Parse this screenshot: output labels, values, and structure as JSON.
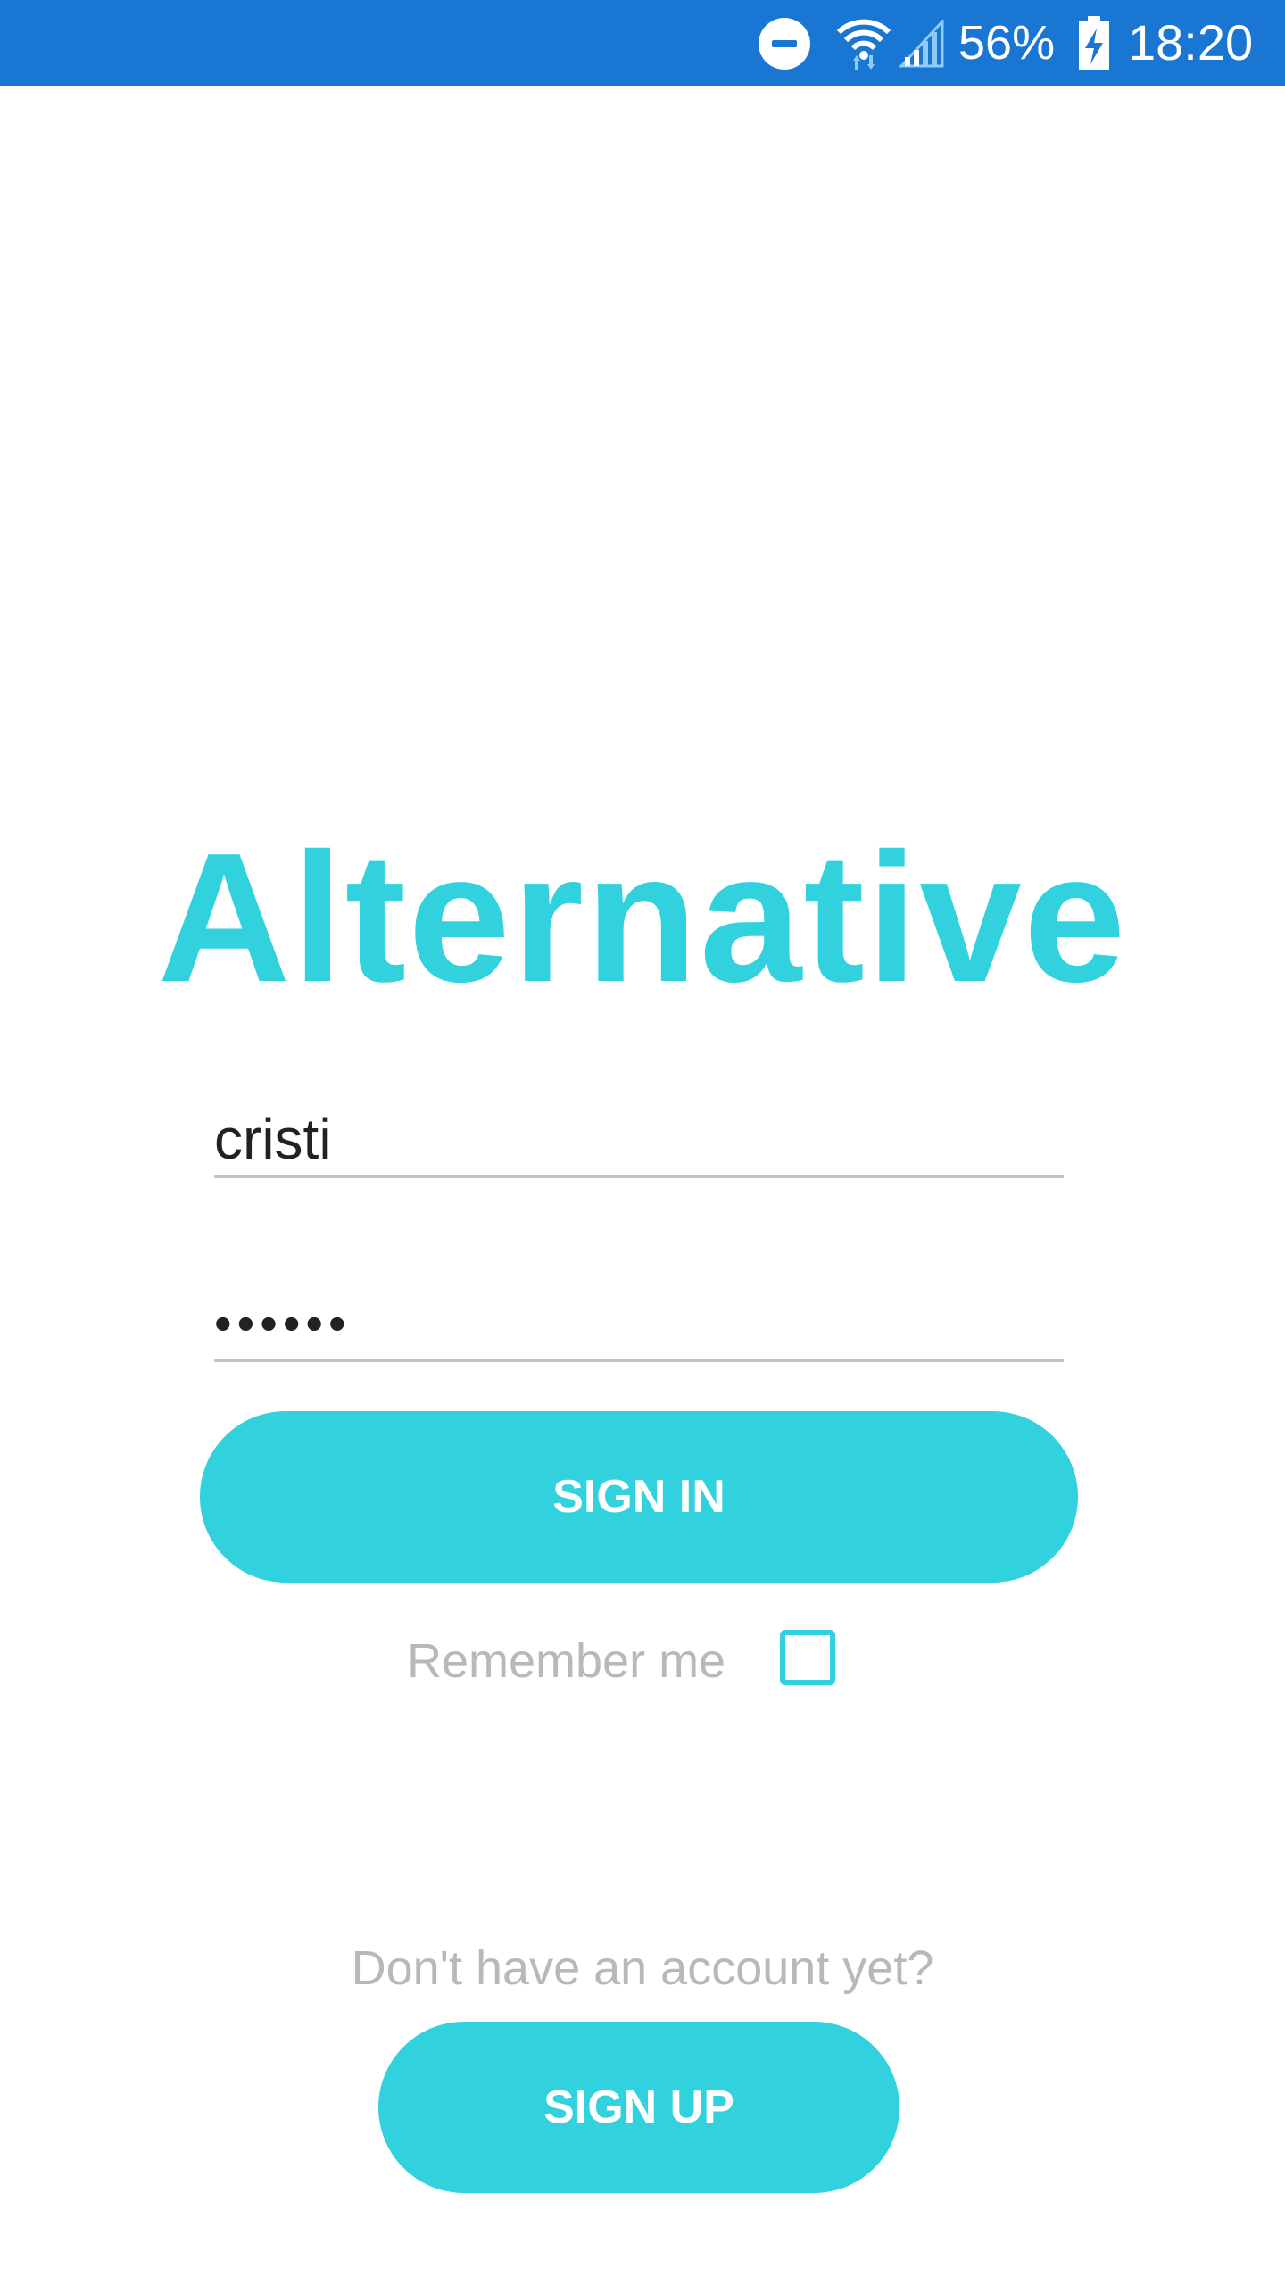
{
  "status_bar": {
    "battery_percent": "56%",
    "time": "18:20",
    "background_color": "#1976d2",
    "icons": [
      "do-not-disturb-icon",
      "wifi-icon",
      "cell-signal-icon",
      "battery-charging-icon"
    ]
  },
  "app": {
    "title": "Alternative",
    "accent_color": "#31d2dd"
  },
  "login_form": {
    "username_value": "cristi",
    "password_value": "••••••",
    "sign_in_label": "SIGN IN",
    "remember_me_label": "Remember me",
    "remember_me_checked": false
  },
  "signup": {
    "prompt": "Don't have an account yet?",
    "sign_up_label": "SIGN UP"
  }
}
